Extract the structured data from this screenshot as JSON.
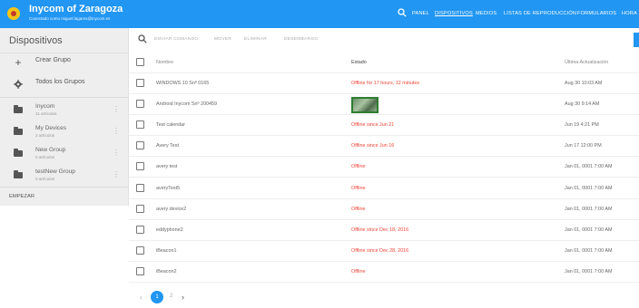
{
  "header": {
    "brand_title": "Inycom of Zaragoza",
    "brand_subtitle": "Conectado como miguel.lagares@inycom.es",
    "nav": [
      "PANEL",
      "DISPOSITIVOS",
      "MEDIOS",
      "LISTAS DE REPRODUCCIÓN",
      "FORMULARIOS",
      "HORA"
    ],
    "active_nav": "DISPOSITIVOS",
    "brand_color": "#2196f3"
  },
  "sidebar": {
    "title": "Dispositivos",
    "create_group": "Crear Grupo",
    "all_groups": "Todos los Grupos",
    "groups": [
      {
        "name": "Inycom",
        "count": "11 artículos"
      },
      {
        "name": "My Devices",
        "count": "2 artículos"
      },
      {
        "name": "New Group",
        "count": "0 artículos"
      },
      {
        "name": "testNew Group",
        "count": "0 artículos"
      }
    ],
    "empezar": "EMPEZAR"
  },
  "toolbar": {
    "buttons": [
      "ENVIAR COMANDO",
      "MOVER",
      "ELIMINAR",
      "DESEMBARGO"
    ]
  },
  "table": {
    "headers": {
      "name": "Nombre",
      "status": "Estado",
      "updated": "Última Actualización"
    },
    "rows": [
      {
        "name": "WINDOWS 10 Snº 0165",
        "status": "Offline for 17 hours, 12 minutes",
        "offline": true,
        "updated": "Aug 30 10:03 AM"
      },
      {
        "name": "Android Inycom Snº 200459",
        "status": "",
        "thumbnail": true,
        "offline": false,
        "updated": "Aug 30 9:14 AM"
      },
      {
        "name": "Test calendar",
        "status": "Offline since Jun 21",
        "offline": true,
        "updated": "Jun 19 4:21 PM"
      },
      {
        "name": "Avery Test",
        "status": "Offline since Jun 16",
        "offline": true,
        "updated": "Jun 17 12:00 PM"
      },
      {
        "name": "avery test",
        "status": "Offline",
        "offline": true,
        "updated": "Jan 01, 0001 7:00 AM"
      },
      {
        "name": "averyTest5",
        "status": "Offline",
        "offline": true,
        "updated": "Jan 01, 0001 7:00 AM"
      },
      {
        "name": "avery device2",
        "status": "Offline",
        "offline": true,
        "updated": "Jan 01, 0001 7:00 AM"
      },
      {
        "name": "eddyphone2",
        "status": "Offline since Dec 18, 2016",
        "offline": true,
        "updated": "Jan 01, 0001 7:00 AM"
      },
      {
        "name": "iBeacon1",
        "status": "Offline since Dec 28, 2016",
        "offline": true,
        "updated": "Jan 01, 0001 7:00 AM"
      },
      {
        "name": "iBeacon2",
        "status": "Offline",
        "offline": true,
        "updated": "Jan 01, 0001 7:00 AM"
      }
    ]
  },
  "pagination": {
    "current": "1",
    "next_page": "2"
  }
}
